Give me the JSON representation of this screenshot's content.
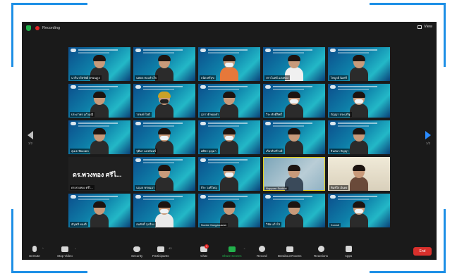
{
  "top": {
    "recording_label": "Recording",
    "view_label": "View"
  },
  "nav": {
    "left_page": "1/2",
    "right_page": "1/2"
  },
  "tiles": [
    {
      "name": "นารีนาถ์ทรัพย์ คชอนุกูล"
    },
    {
      "name": "นพดล ทองสำเร็จ"
    },
    {
      "name": "ธนิต ศรีสุข"
    },
    {
      "name": "ปราโมทย์ แสงทอง"
    },
    {
      "name": "ไพบูลย์ นิลศรี"
    },
    {
      "name": "ประภาพร แก้วมณี"
    },
    {
      "name": "วรพงษ์ ใจดี"
    },
    {
      "name": "สุภาวดี ทองคำ"
    },
    {
      "name": "วีระ ศักดิ์สิทธิ์"
    },
    {
      "name": "กัญญา ประเสริฐ"
    },
    {
      "name": "สุเมธ ชัยมงคล"
    },
    {
      "name": "ชุติมา แสงจันทร์"
    },
    {
      "name": "ศศิธร บุญมา"
    },
    {
      "name": "เกียรติ ศรีวงศ์"
    },
    {
      "name": "จินตนา ปัญญา"
    },
    {
      "name": "ดร.พวงทอง ศรีไ..."
    },
    {
      "name": "นฤมล พรหมมา"
    },
    {
      "name": "ธีระ วงศ์ใหญ่"
    },
    {
      "name": "Nopporn Sukkhit"
    },
    {
      "name": "พิมพ์ใจ มั่นคง"
    },
    {
      "name": "อัญชลี ทองดี"
    },
    {
      "name": "สมศักดิ์ รุ่งเรือง"
    },
    {
      "name": "Nonlai Gangasuwan"
    },
    {
      "name": "วิชัย แก้วใส"
    },
    {
      "name": "Konwit"
    }
  ],
  "big_name": "ดร.พวงทอง ศรีไ...",
  "toolbar": {
    "unmute": "Unmute",
    "stop_video": "Stop Video",
    "security": "Security",
    "participants": "Participants",
    "participants_count": "43",
    "chat": "Chat",
    "chat_badge": "1",
    "share_screen": "Share Screen",
    "record": "Record",
    "breakout": "Breakout Rooms",
    "reactions": "Reactions",
    "apps": "Apps",
    "end": "End"
  }
}
